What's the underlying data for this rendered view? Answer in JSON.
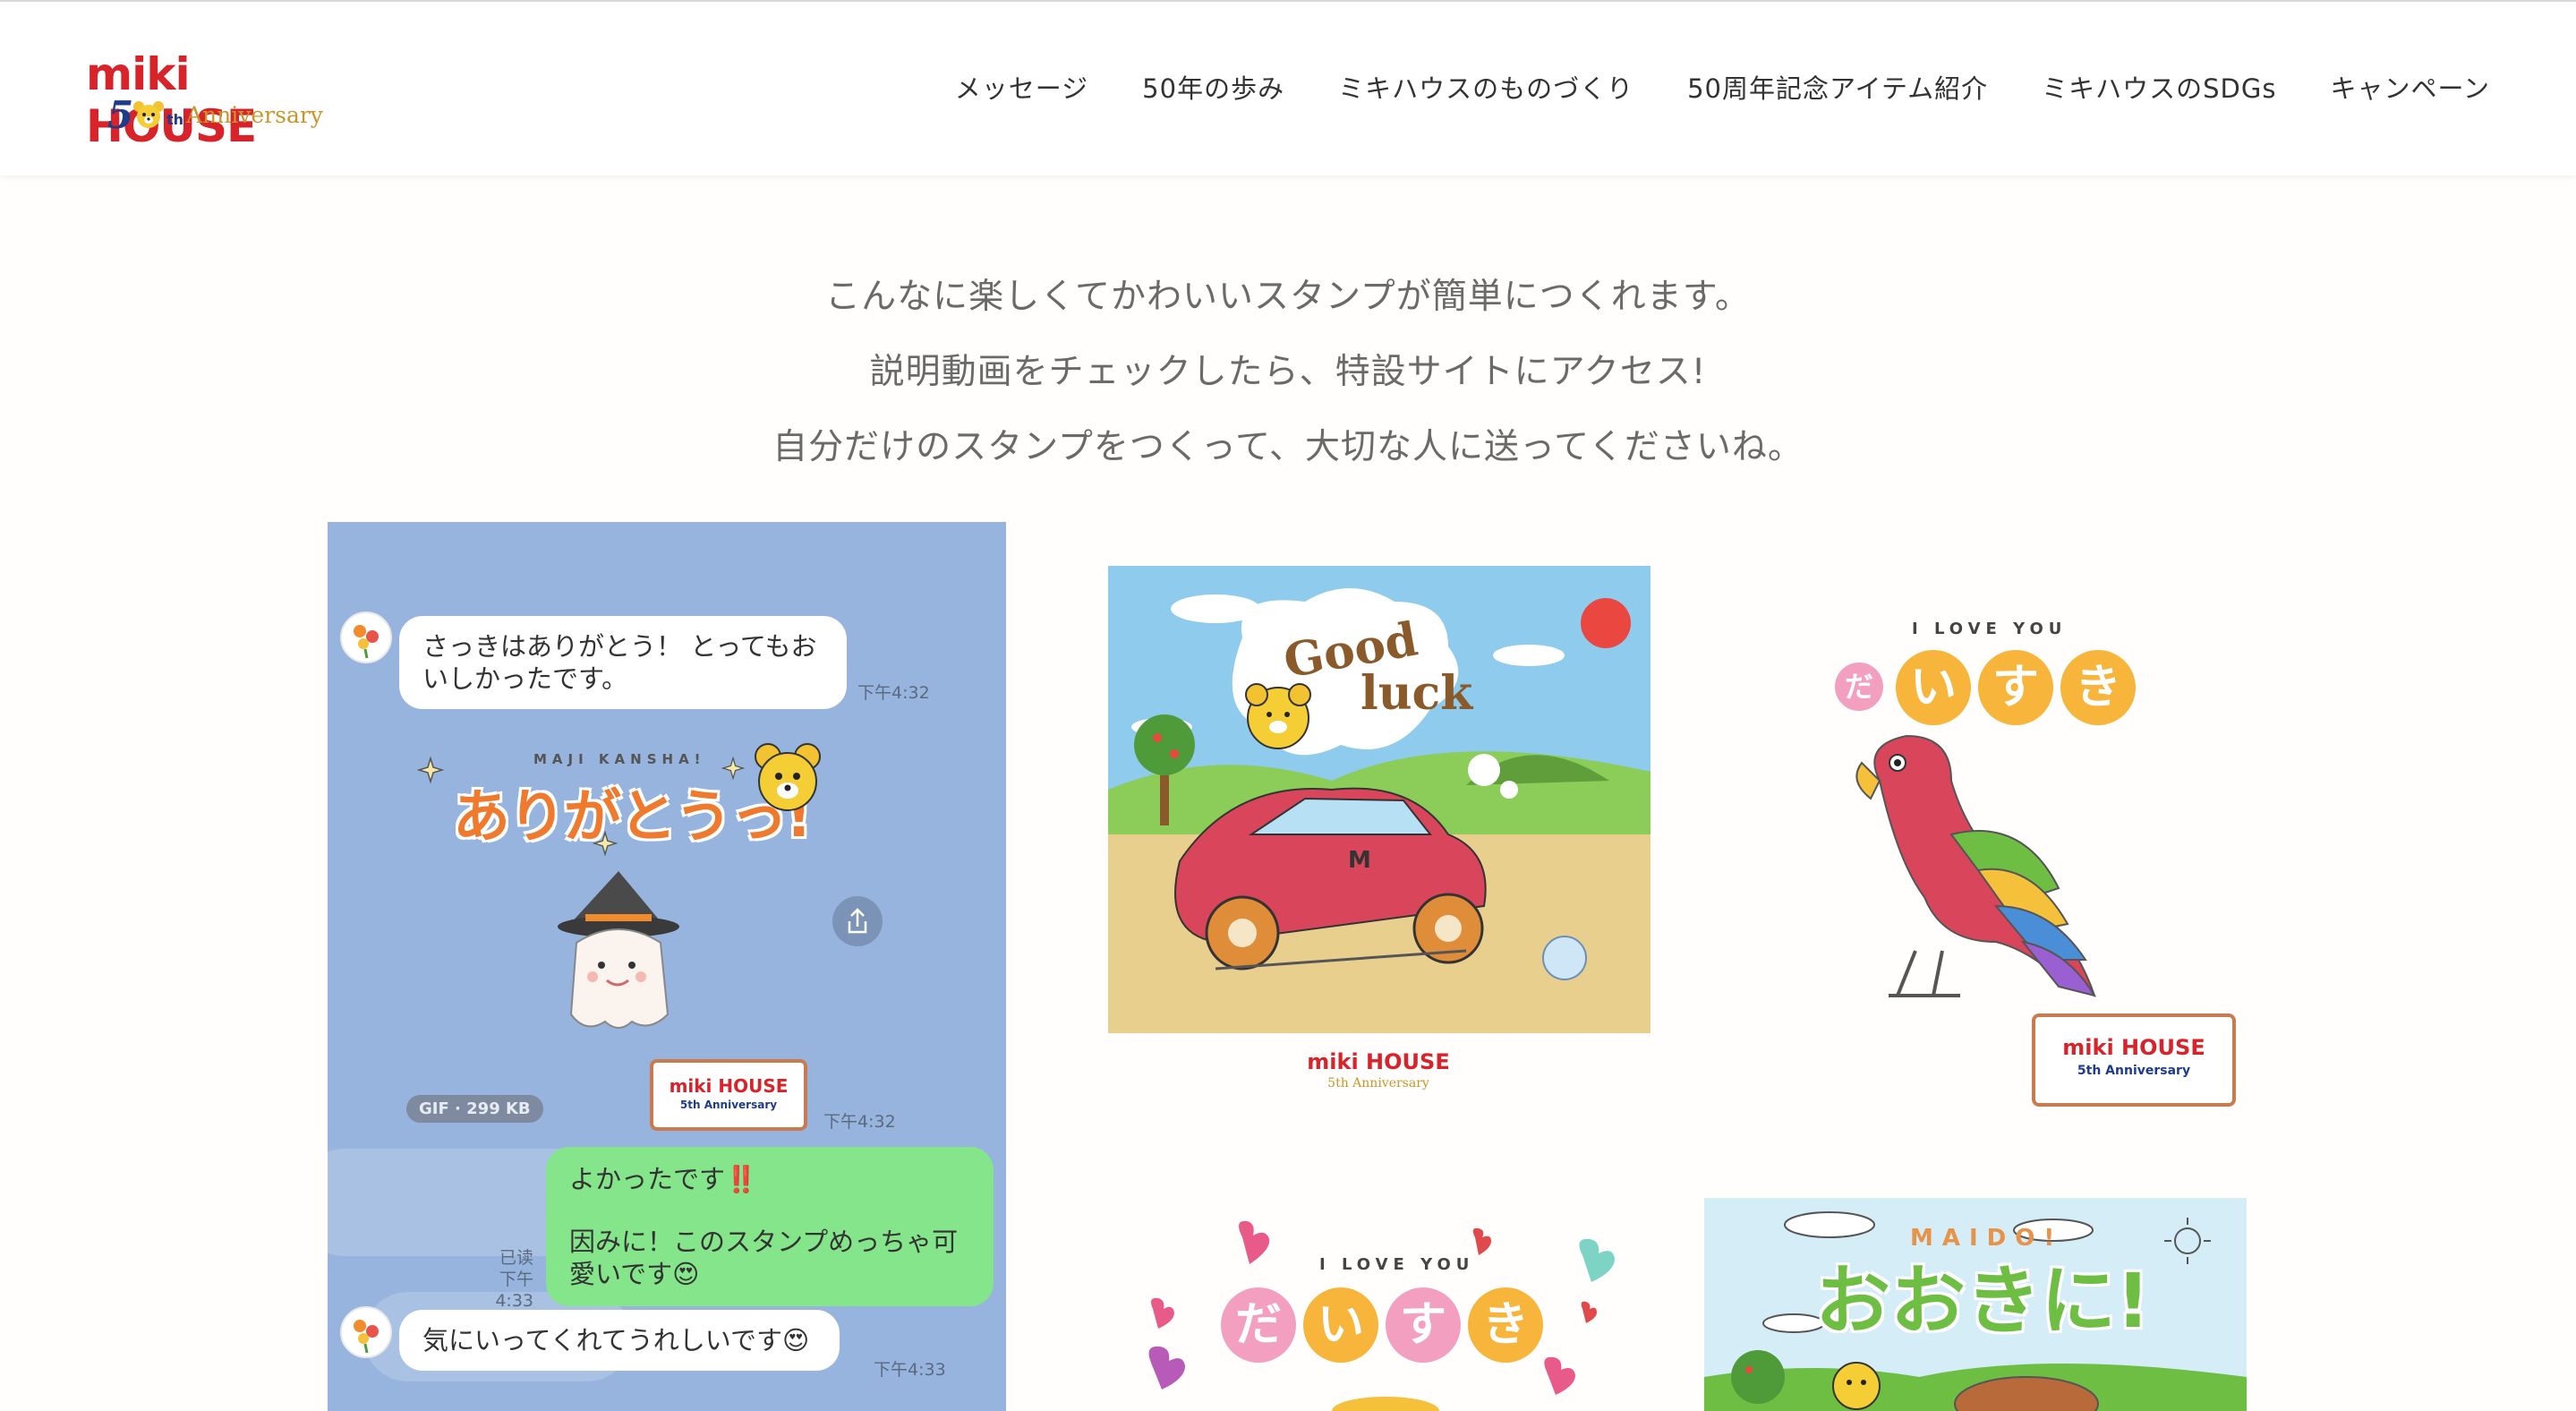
{
  "brand": {
    "logo_word": "miki HOUSE",
    "logo_number": "5",
    "logo_suffix": "th",
    "logo_anniversary": "Anniversary",
    "colors": {
      "red": "#d8232a",
      "navy": "#1f3c8c",
      "gold": "#c8962a"
    }
  },
  "nav": {
    "items": [
      {
        "label": "メッセージ"
      },
      {
        "label": "50年の歩み"
      },
      {
        "label": "ミキハウスのものづくり"
      },
      {
        "label": "50周年記念アイテム紹介"
      },
      {
        "label": "ミキハウスのSDGs"
      },
      {
        "label": "キャンペーン"
      }
    ]
  },
  "intro": {
    "lines": [
      "こんなに楽しくてかわいいスタンプが簡単につくれます。",
      "説明動画をチェックしたら、特設サイトにアクセス!",
      "自分だけのスタンプをつくって、大切な人に送ってくださいね。"
    ]
  },
  "chat": {
    "bg_color": "#96b4dd",
    "msg1": {
      "line1": "さっきはありがとう！ とってもお",
      "line2": "いしかったです。",
      "time": "下午4:32"
    },
    "sticker": {
      "sub": "MAJI KANSHA!",
      "main": "ありがとうっ!",
      "time": "下午4:32",
      "board_word": "miki HOUSE",
      "board_sub": "5th Anniversary"
    },
    "gif_badge": "GIF · 299 KB",
    "msg2": {
      "line1": "よかったです",
      "emoji1": "‼️",
      "line2": "因みに！このスタンプめっちゃ可",
      "line3": "愛いです",
      "emoji2": "😍"
    },
    "msg2_read": "已读",
    "msg2_time": "下午4:33",
    "msg3": {
      "text": "気にいってくれてうれしいです",
      "emoji": "😍",
      "time": "下午4:33"
    }
  },
  "stamps": {
    "goodluck": {
      "line1": "Good",
      "line2": "luck",
      "plate": "M",
      "caption_word": "miki HOUSE",
      "caption_sub": "5th Anniversary"
    },
    "parrot": {
      "top": "I LOVE YOU",
      "chars": [
        "だ",
        "い",
        "す",
        "き"
      ],
      "board_word": "miki HOUSE",
      "board_sub": "5th Anniversary"
    },
    "hearts": {
      "top": "I LOVE YOU",
      "chars": [
        "だ",
        "い",
        "す",
        "き"
      ]
    },
    "maido": {
      "sub": "MAIDO!",
      "main": "おおきに!"
    }
  }
}
